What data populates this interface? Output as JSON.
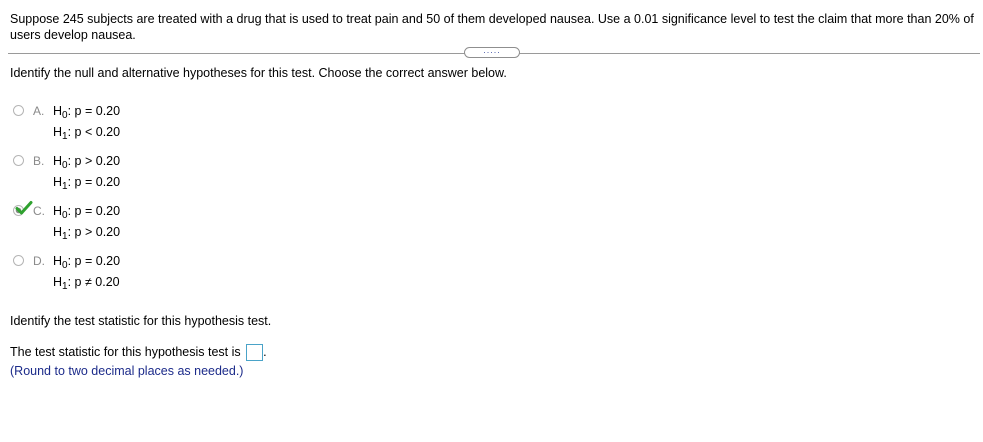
{
  "problem": {
    "text": "Suppose 245 subjects are treated with a drug that is used to treat pain and 50 of them developed nausea. Use a 0.01 significance level to test the claim that more than 20% of users develop nausea."
  },
  "more_button": {
    "label": "....."
  },
  "question1": {
    "prompt": "Identify the null and alternative hypotheses for this test. Choose the correct answer below.",
    "selected": "C",
    "options": [
      {
        "letter": "A.",
        "h0": {
          "sym": "H",
          "sub": "0",
          "rel": ": p = 0.20"
        },
        "h1": {
          "sym": "H",
          "sub": "1",
          "rel": ": p < 0.20"
        }
      },
      {
        "letter": "B.",
        "h0": {
          "sym": "H",
          "sub": "0",
          "rel": ": p > 0.20"
        },
        "h1": {
          "sym": "H",
          "sub": "1",
          "rel": ": p = 0.20"
        }
      },
      {
        "letter": "C.",
        "h0": {
          "sym": "H",
          "sub": "0",
          "rel": ": p = 0.20"
        },
        "h1": {
          "sym": "H",
          "sub": "1",
          "rel": ": p > 0.20"
        }
      },
      {
        "letter": "D.",
        "h0": {
          "sym": "H",
          "sub": "0",
          "rel": ": p = 0.20"
        },
        "h1": {
          "sym": "H",
          "sub": "1",
          "rel": ": p ≠ 0.20"
        }
      }
    ]
  },
  "question2": {
    "prompt": "Identify the test statistic for this hypothesis test.",
    "answer_label": "The test statistic for this hypothesis test is",
    "answer_value": "",
    "answer_suffix": ".",
    "hint": "(Round to two decimal places as needed.)"
  },
  "colors": {
    "check": "#2fa12f",
    "hint": "#1c2b8a",
    "input_border": "#4aa3c8"
  },
  "icons": {
    "correct": "checkmark-icon"
  }
}
